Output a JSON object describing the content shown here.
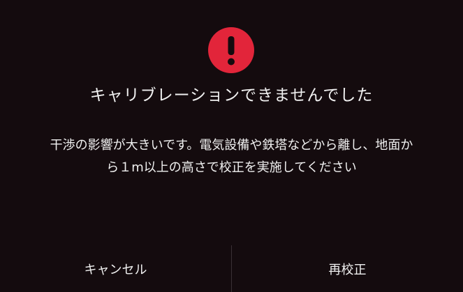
{
  "dialog": {
    "icon": "exclamation-circle-icon",
    "icon_color": "#e2253a",
    "title": "キャリブレーションできませんでした",
    "message_line1": "干渉の影響が大きいです。電気設備や鉄塔などから離し、地面か",
    "message_line2": "ら１m以上の高さで校正を実施してください"
  },
  "buttons": {
    "cancel_label": "キャンセル",
    "recalibrate_label": "再校正"
  }
}
